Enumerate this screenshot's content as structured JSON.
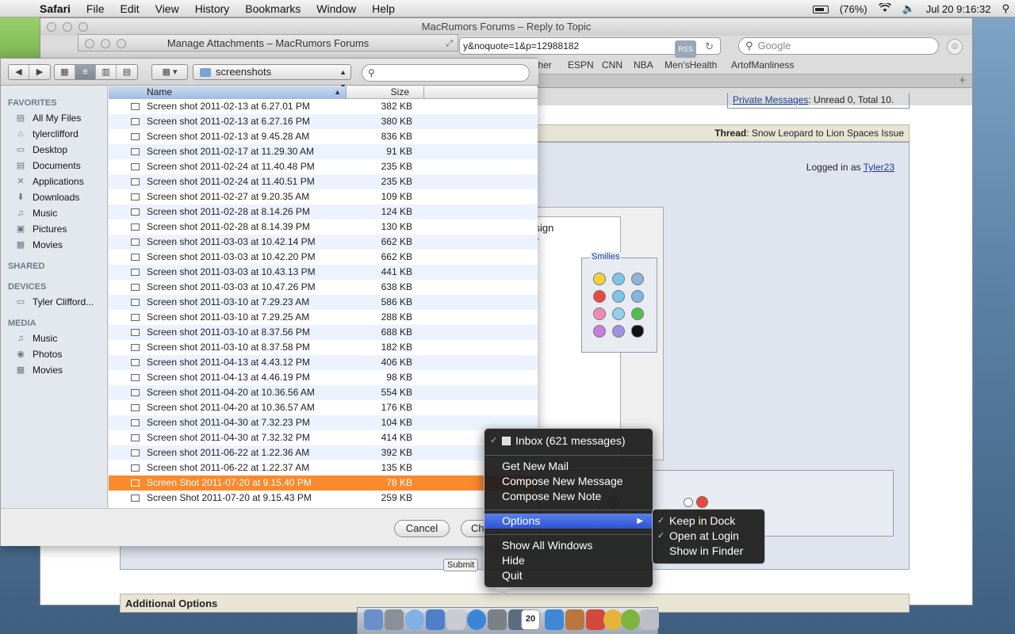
{
  "menubar": {
    "app": "Safari",
    "items": [
      "File",
      "Edit",
      "View",
      "History",
      "Bookmarks",
      "Window",
      "Help"
    ],
    "battery": "(76%)",
    "clock": "Jul 20  9:16:32"
  },
  "safari": {
    "title": "MacRumors Forums – Reply to Topic",
    "url": "y&noquote=1&p=12988182",
    "rss": "RSS",
    "search_placeholder": "Google",
    "bookmarks": [
      "ther",
      "ESPN",
      "CNN",
      "NBA",
      "Men'sHealth",
      "ArtofManliness"
    ]
  },
  "forum": {
    "pm_label": "Private Messages",
    "pm_text": ": Unread 0, Total 10.",
    "thread_label": "Thread",
    "thread_title": ": Snow Leopard to Lion Spaces Issue",
    "logged_prefix": "Logged in as ",
    "logged_user": "Tyler23",
    "msg_fragment_1": "ssign",
    "msg_fragment_2": "er",
    "smilies_label": "Smilies",
    "submit_label": "Submit",
    "additional_options": "Additional Options"
  },
  "manage_window": {
    "title": "Manage Attachments – MacRumors Forums"
  },
  "open_dialog": {
    "folder": "screenshots",
    "search_value": "",
    "sidebar": {
      "favorites_header": "FAVORITES",
      "favorites": [
        {
          "label": "All My Files",
          "icon": "all-files-icon"
        },
        {
          "label": "tylerclifford",
          "icon": "home-icon"
        },
        {
          "label": "Desktop",
          "icon": "desktop-icon"
        },
        {
          "label": "Documents",
          "icon": "documents-icon"
        },
        {
          "label": "Applications",
          "icon": "applications-icon"
        },
        {
          "label": "Downloads",
          "icon": "downloads-icon"
        },
        {
          "label": "Music",
          "icon": "music-icon"
        },
        {
          "label": "Pictures",
          "icon": "pictures-icon"
        },
        {
          "label": "Movies",
          "icon": "movies-icon"
        }
      ],
      "shared_header": "SHARED",
      "devices_header": "DEVICES",
      "devices": [
        {
          "label": "Tyler Clifford...",
          "icon": "disk-icon"
        }
      ],
      "media_header": "MEDIA",
      "media": [
        {
          "label": "Music",
          "icon": "music-icon"
        },
        {
          "label": "Photos",
          "icon": "photos-icon"
        },
        {
          "label": "Movies",
          "icon": "movies-icon"
        }
      ]
    },
    "columns": {
      "name": "Name",
      "size": "Size"
    },
    "files": [
      {
        "name": "Screen shot 2011-02-13 at 6.27.01 PM",
        "size": "382 KB"
      },
      {
        "name": "Screen shot 2011-02-13 at 6.27.16 PM",
        "size": "380 KB"
      },
      {
        "name": "Screen shot 2011-02-13 at 9.45.28 AM",
        "size": "836 KB"
      },
      {
        "name": "Screen shot 2011-02-17 at 11.29.30 AM",
        "size": "91 KB"
      },
      {
        "name": "Screen shot 2011-02-24 at 11.40.48 PM",
        "size": "235 KB"
      },
      {
        "name": "Screen shot 2011-02-24 at 11.40.51 PM",
        "size": "235 KB"
      },
      {
        "name": "Screen shot 2011-02-27 at 9.20.35 AM",
        "size": "109 KB"
      },
      {
        "name": "Screen shot 2011-02-28 at 8.14.26 PM",
        "size": "124 KB"
      },
      {
        "name": "Screen shot 2011-02-28 at 8.14.39 PM",
        "size": "130 KB"
      },
      {
        "name": "Screen shot 2011-03-03 at 10.42.14 PM",
        "size": "662 KB"
      },
      {
        "name": "Screen shot 2011-03-03 at 10.42.20 PM",
        "size": "662 KB"
      },
      {
        "name": "Screen shot 2011-03-03 at 10.43.13 PM",
        "size": "441 KB"
      },
      {
        "name": "Screen shot 2011-03-03 at 10.47.26 PM",
        "size": "638 KB"
      },
      {
        "name": "Screen shot 2011-03-10 at 7.29.23 AM",
        "size": "586 KB"
      },
      {
        "name": "Screen shot 2011-03-10 at 7.29.25 AM",
        "size": "288 KB"
      },
      {
        "name": "Screen shot 2011-03-10 at 8.37.56 PM",
        "size": "688 KB"
      },
      {
        "name": "Screen shot 2011-03-10 at 8.37.58 PM",
        "size": "182 KB"
      },
      {
        "name": "Screen shot 2011-04-13 at 4.43.12 PM",
        "size": "406 KB"
      },
      {
        "name": "Screen shot 2011-04-13 at 4.46.19 PM",
        "size": "98 KB"
      },
      {
        "name": "Screen shot 2011-04-20 at 10.36.56 AM",
        "size": "554 KB"
      },
      {
        "name": "Screen shot 2011-04-20 at 10.36.57 AM",
        "size": "176 KB"
      },
      {
        "name": "Screen shot 2011-04-30 at 7.32.23 PM",
        "size": "104 KB"
      },
      {
        "name": "Screen shot 2011-04-30 at 7.32.32 PM",
        "size": "414 KB"
      },
      {
        "name": "Screen shot 2011-06-22 at 1.22.36 AM",
        "size": "392 KB"
      },
      {
        "name": "Screen shot 2011-06-22 at 1.22.37 AM",
        "size": "135 KB"
      },
      {
        "name": "Screen Shot 2011-07-20 at 9.15.40 PM",
        "size": "78 KB",
        "selected": true
      },
      {
        "name": "Screen Shot 2011-07-20 at 9.15.43 PM",
        "size": "259 KB"
      }
    ],
    "cancel_label": "Cancel",
    "choose_label": "Ch"
  },
  "context_menu": {
    "inbox": "Inbox (621 messages)",
    "get_new_mail": "Get New Mail",
    "compose_message": "Compose New Message",
    "compose_note": "Compose New Note",
    "options": "Options",
    "show_all_windows": "Show All Windows",
    "hide": "Hide",
    "quit": "Quit"
  },
  "submenu": {
    "keep_in_dock": "Keep in Dock",
    "open_at_login": "Open at Login",
    "show_in_finder": "Show in Finder"
  },
  "dock": {
    "calendar_day": "20"
  },
  "colors": {
    "selection": "#f98a2e",
    "menu_highlight": "#2c54d6",
    "link": "#1c3f94"
  }
}
